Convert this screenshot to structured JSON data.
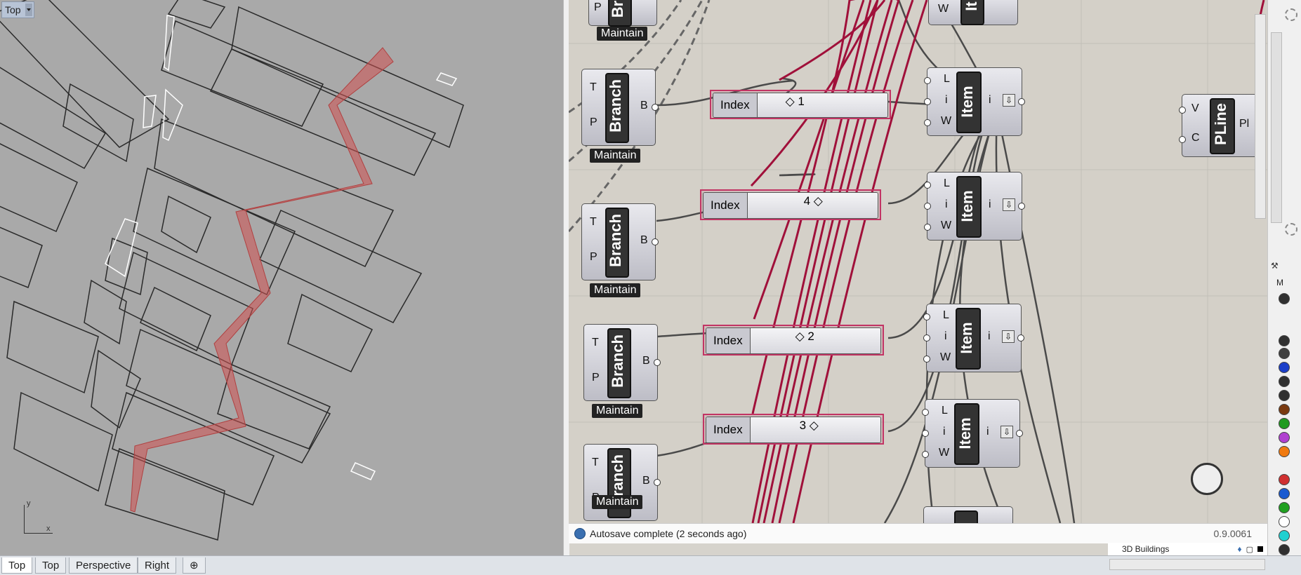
{
  "viewport": {
    "label": "Top",
    "axis_y": "y",
    "axis_x": "x"
  },
  "tabs": [
    {
      "label": "Top"
    },
    {
      "label": "Top"
    },
    {
      "label": "Perspective"
    },
    {
      "label": "Right"
    },
    {
      "label": "⊕"
    }
  ],
  "grasshopper": {
    "branch_components": [
      {
        "name": "Br",
        "inputs": [
          "P"
        ],
        "output": "",
        "tag": "Maintain"
      },
      {
        "name": "Branch",
        "inputs": [
          "T",
          "P"
        ],
        "output": "B",
        "tag": "Maintain"
      },
      {
        "name": "Branch",
        "inputs": [
          "T",
          "P"
        ],
        "output": "B",
        "tag": "Maintain"
      },
      {
        "name": "Branch",
        "inputs": [
          "T",
          "P"
        ],
        "output": "B",
        "tag": "Maintain"
      },
      {
        "name": "Branch",
        "inputs": [
          "T",
          "P"
        ],
        "output": "B",
        "tag": "Maintain"
      }
    ],
    "sliders": [
      {
        "label": "Index",
        "value": "1"
      },
      {
        "label": "Index",
        "value": "4"
      },
      {
        "label": "Index",
        "value": "2"
      },
      {
        "label": "Index",
        "value": "3"
      }
    ],
    "item_components": [
      {
        "name": "It",
        "inputs": [
          "W"
        ],
        "output": ""
      },
      {
        "name": "Item",
        "inputs": [
          "L",
          "i",
          "W"
        ],
        "output": "i"
      },
      {
        "name": "Item",
        "inputs": [
          "L",
          "i",
          "W"
        ],
        "output": "i"
      },
      {
        "name": "Item",
        "inputs": [
          "L",
          "i",
          "W"
        ],
        "output": "i"
      },
      {
        "name": "Item",
        "inputs": [
          "L",
          "i",
          "W"
        ],
        "output": "i"
      }
    ],
    "pline": {
      "name": "PLine",
      "inputs": [
        "V",
        "C"
      ],
      "output": "Pl"
    },
    "status_text": "Autosave complete (2 seconds ago)",
    "version": "0.9.0061"
  },
  "right_panel": {
    "letter": "M",
    "layer_name": "3D Buildings",
    "swatch_colors": [
      "#303030",
      "#303030",
      "#404040",
      "#1a3ec9",
      "#303030",
      "#303030",
      "#7a3a10",
      "#1f9a1f",
      "#b040d0",
      "#f07a10",
      "#d03030",
      "#1a5ad0",
      "#20a020",
      "#ffffff",
      "#20d0d0",
      "#303030"
    ]
  },
  "colors": {
    "wire_red": "#a0103a",
    "wire_dark": "#4a4a4a",
    "path_red": "#d05050"
  }
}
